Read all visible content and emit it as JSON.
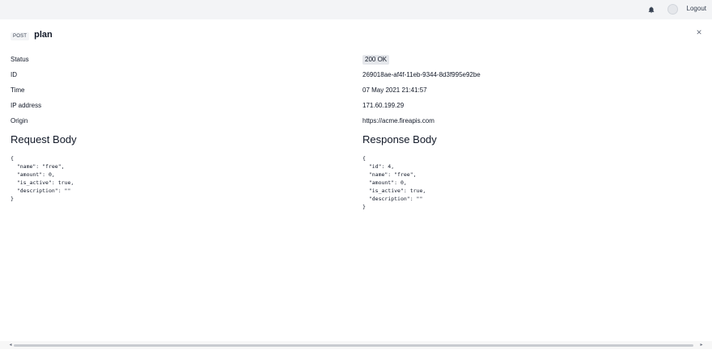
{
  "topbar": {
    "logout_label": "Logout",
    "bell_icon": "bell-icon",
    "avatar_icon": "avatar"
  },
  "request": {
    "method": "POST",
    "title": "plan",
    "close_icon": "close-icon",
    "fields": [
      {
        "label": "Status",
        "value": "200 OK"
      },
      {
        "label": "ID",
        "value": "269018ae-af4f-11eb-9344-8d3f995e92be"
      },
      {
        "label": "Time",
        "value": "07 May 2021 21:41:57"
      },
      {
        "label": "IP address",
        "value": "171.60.199.29"
      },
      {
        "label": "Origin",
        "value": "https://acme.fireapis.com"
      }
    ]
  },
  "request_body": {
    "title": "Request Body",
    "code": "{\n  \"name\": \"free\",\n  \"amount\": 0,\n  \"is_active\": true,\n  \"description\": \"\"\n}"
  },
  "response_body": {
    "title": "Response Body",
    "code": "{\n  \"id\": 4,\n  \"name\": \"free\",\n  \"amount\": 0,\n  \"is_active\": true,\n  \"description\": \"\"\n}"
  },
  "scrollbar": {
    "left_arrow": "◂",
    "right_arrow": "▸"
  },
  "colors": {
    "topbar_bg": "#f3f4f6",
    "badge_bg": "#e5e7eb",
    "text": "#111827"
  }
}
